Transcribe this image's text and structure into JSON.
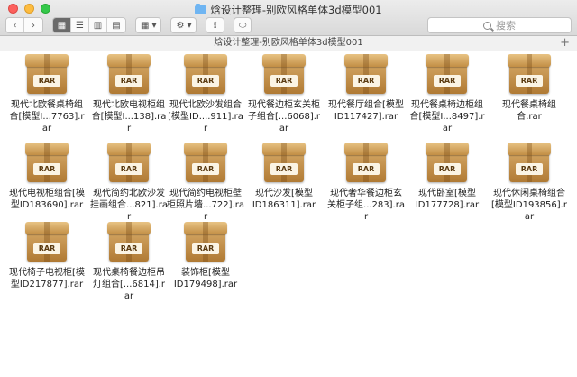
{
  "window": {
    "title": "焓设计整理-别欧风格单体3d模型001"
  },
  "toolbar": {
    "back_glyph": "‹",
    "forward_glyph": "›",
    "view_icons_glyph": "▦",
    "view_list_glyph": "☰",
    "view_columns_glyph": "▥",
    "view_gallery_glyph": "▤",
    "group_glyph": "▦",
    "group_arrow": "▾",
    "action_glyph": "⚙",
    "action_arrow": "▾",
    "share_glyph": "⇪",
    "tag_glyph": "⬭",
    "search_placeholder": "搜索"
  },
  "pathbar": {
    "title": "焓设计整理-别欧风格单体3d模型001",
    "plus": "+"
  },
  "file_badge": "RAR",
  "files": [
    {
      "line1": "现代北欧餐桌椅组",
      "line2": "合[模型I...7763].rar"
    },
    {
      "line1": "现代北欧电视柜组",
      "line2": "合[模型I...138].rar"
    },
    {
      "line1": "现代北欧沙发组合",
      "line2": "[模型ID....911].rar"
    },
    {
      "line1": "现代餐边柜玄关柜",
      "line2": "子组合[...6068].rar"
    },
    {
      "line1": "现代餐厅组合[模型",
      "line2": "ID117427].rar"
    },
    {
      "line1": "现代餐桌椅边柜组",
      "line2": "合[模型I...8497].rar"
    },
    {
      "line1": "现代餐桌椅组",
      "line2": "合.rar"
    },
    {
      "line1": "现代电视柜组合[模",
      "line2": "型ID183690].rar"
    },
    {
      "line1": "现代简约北欧沙发",
      "line2": "挂画组合...821].rar"
    },
    {
      "line1": "现代简约电视柜壁",
      "line2": "柜照片墙...722].rar"
    },
    {
      "line1": "现代沙发[模型",
      "line2": "ID186311].rar"
    },
    {
      "line1": "现代奢华餐边柜玄",
      "line2": "关柜子组...283].rar"
    },
    {
      "line1": "现代卧室[模型",
      "line2": "ID177728].rar"
    },
    {
      "line1": "现代休闲桌椅组合",
      "line2": "[模型ID193856].rar"
    },
    {
      "line1": "现代椅子电视柜[模",
      "line2": "型ID217877].rar"
    },
    {
      "line1": "现代桌椅餐边柜吊",
      "line2": "灯组合[...6814].rar"
    },
    {
      "line1": "装饰柜[模型",
      "line2": "ID179498].rar"
    }
  ]
}
